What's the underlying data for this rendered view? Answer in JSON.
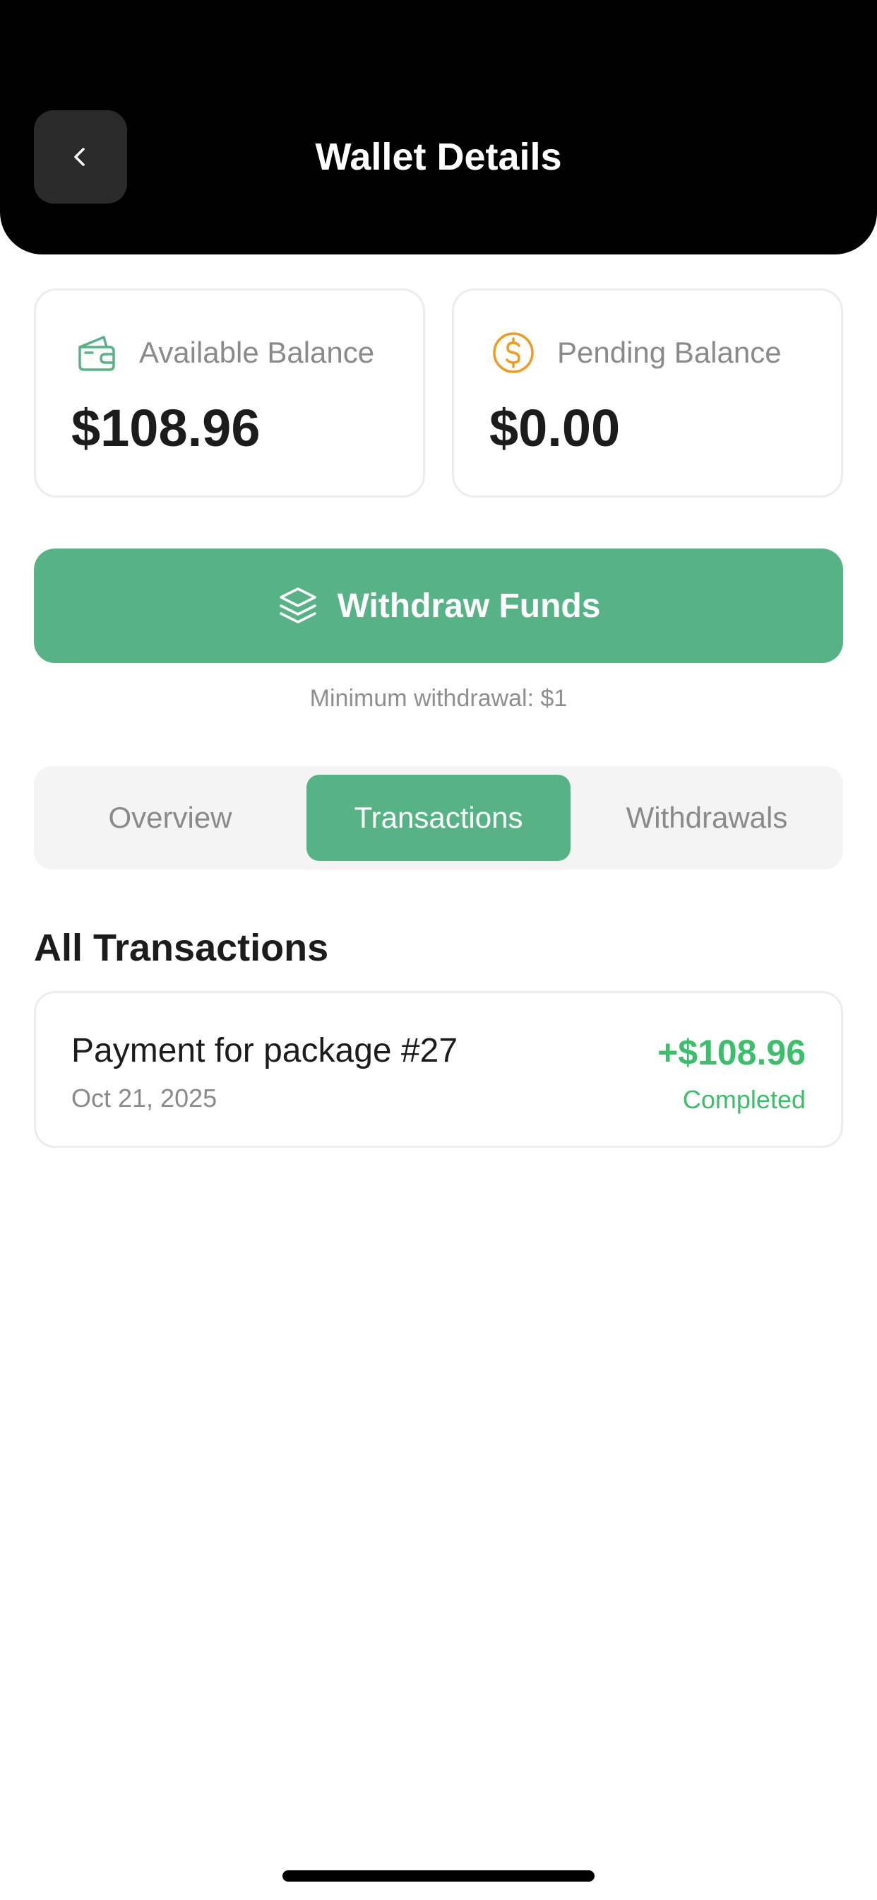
{
  "header": {
    "title": "Wallet Details",
    "back_icon": "chevron-left-icon"
  },
  "balances": {
    "available": {
      "label": "Available Balance",
      "value": "$108.96",
      "icon": "wallet-icon",
      "icon_color": "#57b386"
    },
    "pending": {
      "label": "Pending Balance",
      "value": "$0.00",
      "icon": "dollar-circle-icon",
      "icon_color": "#f29a1f"
    }
  },
  "withdraw": {
    "label": "Withdraw Funds",
    "icon": "layers-icon",
    "note": "Minimum withdrawal: $1"
  },
  "tabs": [
    {
      "label": "Overview",
      "active": false
    },
    {
      "label": "Transactions",
      "active": true
    },
    {
      "label": "Withdrawals",
      "active": false
    }
  ],
  "transactions": {
    "title": "All Transactions",
    "items": [
      {
        "title": "Payment for package #27",
        "date": "Oct 21, 2025",
        "amount": "+$108.96",
        "status": "Completed"
      }
    ]
  },
  "colors": {
    "accent": "#57b386",
    "success": "#3cbf6a",
    "pending": "#f29a1f",
    "header_bg": "#000000"
  }
}
